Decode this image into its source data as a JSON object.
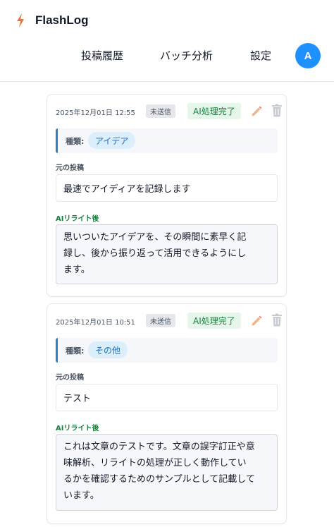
{
  "app": {
    "name": "FlashLog",
    "colors": {
      "accent": "#1e90ff",
      "bolt": "#f0703a",
      "success": "#15803d"
    }
  },
  "nav": {
    "items": [
      {
        "label": "投稿履歴"
      },
      {
        "label": "バッチ分析"
      },
      {
        "label": "設定"
      }
    ]
  },
  "user": {
    "avatar_initial": "A"
  },
  "posts": [
    {
      "timestamp": "2025年12月01日 12:55",
      "send_status": "未送信",
      "ai_status": "AI処理完了",
      "category_label": "種類:",
      "category": "アイデア",
      "original_label": "元の投稿",
      "original": "最速でアイディアを記録します",
      "ai_label": "AIリライト後",
      "ai_lines": [
        "思いついたアイデアを、その瞬間に素早く記",
        "録し、後から振り返って活用できるようにし",
        "ます。"
      ]
    },
    {
      "timestamp": "2025年12月01日 10:51",
      "send_status": "未送信",
      "ai_status": "AI処理完了",
      "category_label": "種類:",
      "category": "その他",
      "original_label": "元の投稿",
      "original": "テスト",
      "ai_label": "AIリライト後",
      "ai_lines": [
        "これは文章のテストです。文章の誤字訂正や意",
        "味解析、リライトの処理が正しく動作してい",
        "るかを確認するためのサンプルとして記載して",
        "います。"
      ]
    }
  ],
  "icons": {
    "brand": "lightning-icon",
    "edit": "pencil-icon",
    "delete": "trash-icon"
  }
}
